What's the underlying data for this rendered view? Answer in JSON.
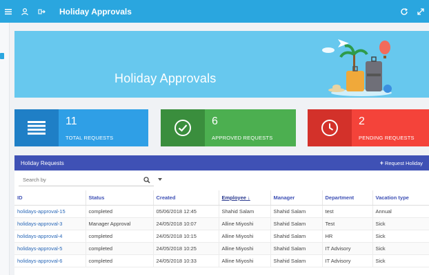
{
  "header": {
    "title": "Holiday Approvals",
    "left_icons": [
      "menu-icon",
      "user-icon",
      "signout-icon"
    ],
    "right_icons": [
      "refresh-icon",
      "expand-icon"
    ]
  },
  "banner": {
    "title": "Holiday Approvals"
  },
  "stats": [
    {
      "value": "11",
      "label": "TOTAL REQUESTS",
      "icon": "list-icon",
      "color": "#2f9fe6"
    },
    {
      "value": "6",
      "label": "APPROVED REQUESTS",
      "icon": "check-circle-icon",
      "color": "#4caf50"
    },
    {
      "value": "2",
      "label": "PENDING REQUESTS",
      "icon": "clock-icon",
      "color": "#f4433a"
    }
  ],
  "requests": {
    "title": "Holiday Requests",
    "request_button": "Request Holiday",
    "search_placeholder": "Search by",
    "columns": [
      "ID",
      "Status",
      "Created",
      "Employee",
      "Manager",
      "Department",
      "Vacation type"
    ],
    "sorted_column": "Employee",
    "rows": [
      [
        "holidays-approval-15",
        "completed",
        "05/06/2018 12:45",
        "Shahid Salam",
        "Shahid Salam",
        "test",
        "Annual"
      ],
      [
        "holidays-approval-3",
        "Manager Approval",
        "24/05/2018 10:07",
        "Alline Miyoshi",
        "Shahid Salam",
        "Test",
        "Sick"
      ],
      [
        "holidays-approval-4",
        "completed",
        "24/05/2018 10:15",
        "Alline Miyoshi",
        "Shahid Salam",
        "HR",
        "Sick"
      ],
      [
        "holidays-approval-5",
        "completed",
        "24/05/2018 10:25",
        "Alline Miyoshi",
        "Shahid Salam",
        "IT Advisory",
        "Sick"
      ],
      [
        "holidays-approval-6",
        "completed",
        "24/05/2018 10:33",
        "Alline Miyoshi",
        "Shahid Salam",
        "IT Advisory",
        "Sick"
      ]
    ]
  }
}
